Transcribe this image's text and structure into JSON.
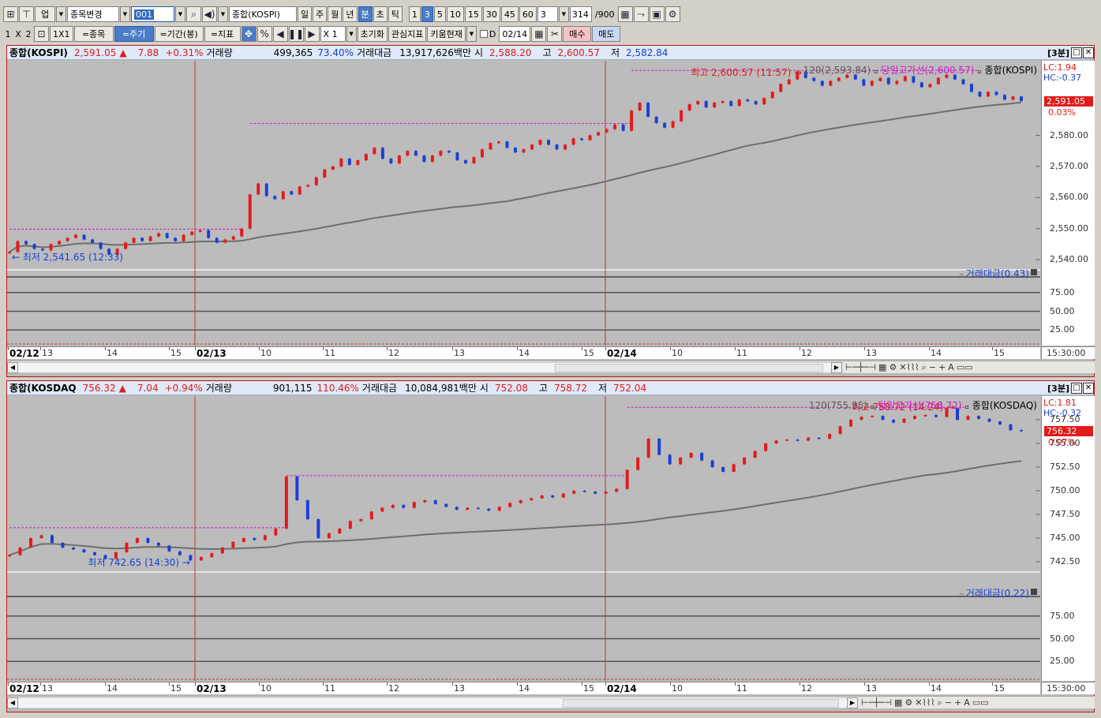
{
  "toolbar1": {
    "market_label": "업",
    "change_label": "종목변경",
    "code_value": "001",
    "index_name": "종합(KOSPI)",
    "periods": [
      "일",
      "주",
      "월",
      "년",
      "분",
      "초",
      "틱"
    ],
    "active_period": "분",
    "intervals": [
      "1",
      "3",
      "5",
      "10",
      "15",
      "30",
      "45",
      "60"
    ],
    "active_interval": "3",
    "interval_value": "3",
    "count": "314",
    "count_max": "/900"
  },
  "toolbar2": {
    "layout": [
      "1",
      "X",
      "2"
    ],
    "one_by_one": "1X1",
    "btn_item": "=종목",
    "btn_cycle": "=주기",
    "btn_period": "=기간(봉)",
    "btn_indicator": "=지표",
    "pct": "%",
    "mult": "X 1",
    "reset": "초기화",
    "watch": "관심지표",
    "kiwoom": "키움현재",
    "d_label": "D",
    "date": "02/14",
    "buy": "매수",
    "sell": "매도"
  },
  "colors": {
    "up": "#e21b1b",
    "down": "#1b3fd6",
    "highline": "#d018c8",
    "ma": "#6e6e6e",
    "tag": "#e21b1b"
  },
  "charts": [
    {
      "name": "종합(KOSPI)",
      "price": "2,591.05",
      "arrow": "▲",
      "change": "7.88",
      "change_pct": "+0.31%",
      "vol_label": "거래량",
      "volume": "499,365",
      "vol_pct": "73.40%",
      "amt_label": "거래대금",
      "amount": "13,917,626백만",
      "open_label": "시",
      "open": "2,588.20",
      "high_label": "고",
      "high": "2,600.57",
      "low_label": "저",
      "low": "2,582.84",
      "period_tag": "[3분]",
      "ma_legend": "120(2,593.84)",
      "high_legend": "당일고가선(2,600.57)",
      "name_legend": "종합(KOSPI)",
      "lc": "LC:1.94",
      "hc": "HC:-0.37",
      "max_ann": "최고 2,600.57 (11:57)",
      "min_ann": "최저 2,541.65 (12:33)",
      "cur_tag": "2,591.05",
      "cur_pct": "0.03%",
      "y_labels": [
        "2,580.00",
        "2,570.00",
        "2,560.00",
        "2,550.00",
        "2,540.00"
      ],
      "sub_legend": "거래대금(0.43)",
      "sub_labels": [
        "75.00",
        "50.00",
        "25.00"
      ],
      "x_labels": [
        "02/12",
        "13",
        "14",
        "15",
        "02/13",
        "10",
        "11",
        "12",
        "13",
        "14",
        "15",
        "02/14",
        "10",
        "11",
        "12",
        "13",
        "14",
        "15"
      ],
      "time": "15:30:00",
      "chart_data": {
        "type": "candlestick",
        "title": "종합(KOSPI)",
        "ylim": [
          2537,
          2604
        ],
        "day_start_index": [
          0,
          52,
          178
        ],
        "close_path": [
          2542.5,
          2546,
          2545,
          2543.5,
          2543,
          2545,
          2546,
          2547,
          2548,
          2546.5,
          2545.5,
          2543.5,
          2541.65,
          2543.5,
          2545.5,
          2547,
          2546,
          2547.5,
          2548.5,
          2547,
          2546,
          2548,
          2549,
          2549.5,
          2547,
          2545.5,
          2546.5,
          2547.5,
          2550,
          2561,
          2564.5,
          2560.5,
          2559.5,
          2562,
          2561,
          2563.5,
          2564,
          2566.5,
          2569,
          2570,
          2572.5,
          2570.5,
          2572,
          2574,
          2576,
          2572.5,
          2571,
          2573.5,
          2575,
          2573.5,
          2571.5,
          2573.5,
          2575,
          2574.5,
          2572,
          2571,
          2573,
          2575.5,
          2577.5,
          2578,
          2576,
          2574.5,
          2575.5,
          2577,
          2578.5,
          2577,
          2575.5,
          2577,
          2579,
          2578.5,
          2580,
          2581,
          2582,
          2583.5,
          2581.5,
          2588,
          2590.5,
          2586,
          2584,
          2582.5,
          2584.5,
          2588,
          2590,
          2591,
          2589,
          2590.5,
          2591,
          2589.5,
          2591.5,
          2591,
          2590,
          2592,
          2594,
          2596.5,
          2598,
          2600.57,
          2598.5,
          2597.5,
          2596,
          2597.5,
          2598.5,
          2599.5,
          2598,
          2596,
          2597.5,
          2598.5,
          2596.5,
          2597.5,
          2599,
          2597,
          2595.5,
          2596.5,
          2598.5,
          2599.5,
          2598,
          2596.5,
          2594,
          2592.5,
          2594,
          2593,
          2591.5,
          2592.5,
          2591.05
        ]
      }
    },
    {
      "name": "종합(KOSDAQ",
      "price": "756.32",
      "arrow": "▲",
      "change": "7.04",
      "change_pct": "+0.94%",
      "vol_label": "거래량",
      "volume": "901,115",
      "vol_pct": "110.46%",
      "amt_label": "거래대금",
      "amount": "10,084,981백만",
      "open_label": "시",
      "open": "752.08",
      "high_label": "고",
      "high": "758.72",
      "low_label": "저",
      "low": "752.04",
      "period_tag": "[3분]",
      "ma_legend": "120(755.95)",
      "high_legend": "당일고가선(758.72)",
      "name_legend": "종합(KOSDAQ)",
      "lc": "LC:1.81",
      "hc": "HC:-0.32",
      "max_ann": "최고 758.72 (14:24)",
      "min_ann": "최저 742.65 (14:30)",
      "cur_tag": "756.32",
      "cur_pct": "0.07%",
      "y_labels": [
        "757.50",
        "755.00",
        "752.50",
        "750.00",
        "747.50",
        "745.00",
        "742.50"
      ],
      "sub_legend": "거래대금(0.22)",
      "sub_labels": [
        "75.00",
        "50.00",
        "25.00"
      ],
      "x_labels": [
        "02/12",
        "13",
        "14",
        "15",
        "02/13",
        "10",
        "11",
        "12",
        "13",
        "14",
        "15",
        "02/14",
        "10",
        "11",
        "12",
        "13",
        "14",
        "15"
      ],
      "time": "15:30:00",
      "chart_data": {
        "type": "candlestick",
        "title": "종합(KOSDAQ",
        "ylim": [
          741.5,
          760
        ],
        "day_start_index": [
          0,
          52,
          178
        ],
        "close_path": [
          743.2,
          744,
          745,
          745.3,
          744.5,
          744,
          743.8,
          743.5,
          743.2,
          742.8,
          743.5,
          744.5,
          745,
          744.5,
          744.2,
          743.6,
          743.2,
          742.65,
          743,
          743.4,
          744,
          744.6,
          745,
          744.8,
          745.3,
          746,
          751.5,
          749,
          747,
          745,
          745.5,
          746,
          746.8,
          747,
          747.8,
          748.2,
          748.5,
          748.2,
          748.8,
          749,
          748.6,
          748.3,
          748,
          748.2,
          748.1,
          747.9,
          748.3,
          748.7,
          749,
          749.2,
          749.5,
          749.3,
          749.7,
          750,
          749.9,
          749.7,
          749.9,
          750.2,
          752.2,
          753.5,
          755.5,
          753.8,
          752.8,
          753.5,
          754,
          753.2,
          752.5,
          752,
          752.8,
          753.5,
          754.2,
          755,
          755.3,
          755.4,
          755.3,
          755.6,
          755.5,
          756,
          756.8,
          757.5,
          757.8,
          757.9,
          757.5,
          757.2,
          757.6,
          757.9,
          758,
          757.8,
          758.72,
          757.5,
          757.9,
          757.6,
          757.3,
          757,
          756.4,
          756.32
        ]
      }
    }
  ]
}
